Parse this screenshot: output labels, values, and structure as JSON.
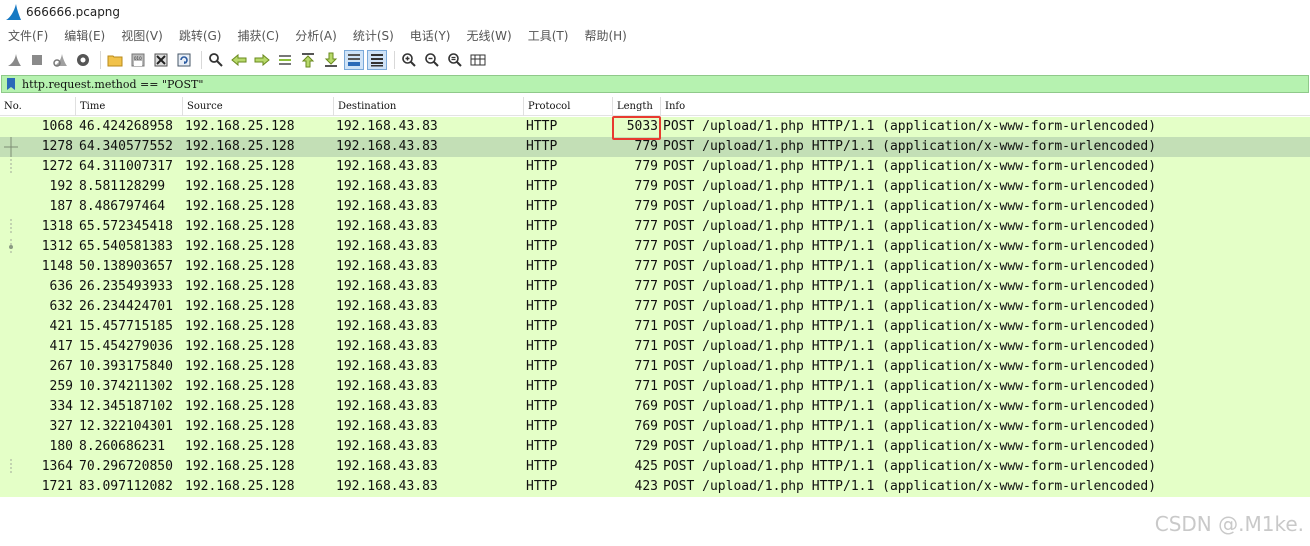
{
  "window": {
    "title": "666666.pcapng",
    "icon": "wireshark-fin-icon"
  },
  "menu": [
    {
      "label": "文件(F)"
    },
    {
      "label": "编辑(E)"
    },
    {
      "label": "视图(V)"
    },
    {
      "label": "跳转(G)"
    },
    {
      "label": "捕获(C)"
    },
    {
      "label": "分析(A)"
    },
    {
      "label": "统计(S)"
    },
    {
      "label": "电话(Y)"
    },
    {
      "label": "无线(W)"
    },
    {
      "label": "工具(T)"
    },
    {
      "label": "帮助(H)"
    }
  ],
  "toolbar": {
    "icons": [
      "start-capture-icon",
      "stop-capture-icon",
      "restart-capture-icon",
      "capture-options-icon",
      "open-file-icon",
      "save-file-icon",
      "close-file-icon",
      "reload-file-icon",
      "find-packet-icon",
      "go-back-icon",
      "go-forward-icon",
      "go-to-packet-icon",
      "first-packet-icon",
      "last-packet-icon",
      "autoscroll-icon",
      "colorize-icon",
      "zoom-in-icon",
      "zoom-out-icon",
      "zoom-normal-icon",
      "resize-columns-icon"
    ],
    "active_icons": [
      "autoscroll-icon",
      "colorize-icon"
    ]
  },
  "filter": {
    "value": "http.request.method == \"POST\"",
    "background": "#b6f2b0"
  },
  "columns": [
    "No.",
    "Time",
    "Source",
    "Destination",
    "Protocol",
    "Length",
    "Info"
  ],
  "packets": [
    {
      "no": "1068",
      "time": "46.424268958",
      "src": "192.168.25.128",
      "dst": "192.168.43.83",
      "proto": "HTTP",
      "len": "5033",
      "info": "POST /upload/1.php HTTP/1.1  (application/x-www-form-urlencoded)"
    },
    {
      "no": "1278",
      "time": "64.340577552",
      "src": "192.168.25.128",
      "dst": "192.168.43.83",
      "proto": "HTTP",
      "len": "779",
      "info": "POST /upload/1.php HTTP/1.1  (application/x-www-form-urlencoded)"
    },
    {
      "no": "1272",
      "time": "64.311007317",
      "src": "192.168.25.128",
      "dst": "192.168.43.83",
      "proto": "HTTP",
      "len": "779",
      "info": "POST /upload/1.php HTTP/1.1  (application/x-www-form-urlencoded)"
    },
    {
      "no": "192",
      "time": "8.581128299",
      "src": "192.168.25.128",
      "dst": "192.168.43.83",
      "proto": "HTTP",
      "len": "779",
      "info": "POST /upload/1.php HTTP/1.1  (application/x-www-form-urlencoded)"
    },
    {
      "no": "187",
      "time": "8.486797464",
      "src": "192.168.25.128",
      "dst": "192.168.43.83",
      "proto": "HTTP",
      "len": "779",
      "info": "POST /upload/1.php HTTP/1.1  (application/x-www-form-urlencoded)"
    },
    {
      "no": "1318",
      "time": "65.572345418",
      "src": "192.168.25.128",
      "dst": "192.168.43.83",
      "proto": "HTTP",
      "len": "777",
      "info": "POST /upload/1.php HTTP/1.1  (application/x-www-form-urlencoded)"
    },
    {
      "no": "1312",
      "time": "65.540581383",
      "src": "192.168.25.128",
      "dst": "192.168.43.83",
      "proto": "HTTP",
      "len": "777",
      "info": "POST /upload/1.php HTTP/1.1  (application/x-www-form-urlencoded)"
    },
    {
      "no": "1148",
      "time": "50.138903657",
      "src": "192.168.25.128",
      "dst": "192.168.43.83",
      "proto": "HTTP",
      "len": "777",
      "info": "POST /upload/1.php HTTP/1.1  (application/x-www-form-urlencoded)"
    },
    {
      "no": "636",
      "time": "26.235493933",
      "src": "192.168.25.128",
      "dst": "192.168.43.83",
      "proto": "HTTP",
      "len": "777",
      "info": "POST /upload/1.php HTTP/1.1  (application/x-www-form-urlencoded)"
    },
    {
      "no": "632",
      "time": "26.234424701",
      "src": "192.168.25.128",
      "dst": "192.168.43.83",
      "proto": "HTTP",
      "len": "777",
      "info": "POST /upload/1.php HTTP/1.1  (application/x-www-form-urlencoded)"
    },
    {
      "no": "421",
      "time": "15.457715185",
      "src": "192.168.25.128",
      "dst": "192.168.43.83",
      "proto": "HTTP",
      "len": "771",
      "info": "POST /upload/1.php HTTP/1.1  (application/x-www-form-urlencoded)"
    },
    {
      "no": "417",
      "time": "15.454279036",
      "src": "192.168.25.128",
      "dst": "192.168.43.83",
      "proto": "HTTP",
      "len": "771",
      "info": "POST /upload/1.php HTTP/1.1  (application/x-www-form-urlencoded)"
    },
    {
      "no": "267",
      "time": "10.393175840",
      "src": "192.168.25.128",
      "dst": "192.168.43.83",
      "proto": "HTTP",
      "len": "771",
      "info": "POST /upload/1.php HTTP/1.1  (application/x-www-form-urlencoded)"
    },
    {
      "no": "259",
      "time": "10.374211302",
      "src": "192.168.25.128",
      "dst": "192.168.43.83",
      "proto": "HTTP",
      "len": "771",
      "info": "POST /upload/1.php HTTP/1.1  (application/x-www-form-urlencoded)"
    },
    {
      "no": "334",
      "time": "12.345187102",
      "src": "192.168.25.128",
      "dst": "192.168.43.83",
      "proto": "HTTP",
      "len": "769",
      "info": "POST /upload/1.php HTTP/1.1  (application/x-www-form-urlencoded)"
    },
    {
      "no": "327",
      "time": "12.322104301",
      "src": "192.168.25.128",
      "dst": "192.168.43.83",
      "proto": "HTTP",
      "len": "769",
      "info": "POST /upload/1.php HTTP/1.1  (application/x-www-form-urlencoded)"
    },
    {
      "no": "180",
      "time": "8.260686231",
      "src": "192.168.25.128",
      "dst": "192.168.43.83",
      "proto": "HTTP",
      "len": "729",
      "info": "POST /upload/1.php HTTP/1.1  (application/x-www-form-urlencoded)"
    },
    {
      "no": "1364",
      "time": "70.296720850",
      "src": "192.168.25.128",
      "dst": "192.168.43.83",
      "proto": "HTTP",
      "len": "425",
      "info": "POST /upload/1.php HTTP/1.1  (application/x-www-form-urlencoded)"
    },
    {
      "no": "1721",
      "time": "83.097112082",
      "src": "192.168.25.128",
      "dst": "192.168.43.83",
      "proto": "HTTP",
      "len": "423",
      "info": "POST /upload/1.php HTTP/1.1  (application/x-www-form-urlencoded)"
    }
  ],
  "selected_packet": "1278",
  "highlighted_packet": "1068",
  "colors": {
    "row_bg": "#e4ffc7",
    "selected_bg": "#c3dfb6",
    "highlight_border": "#e83a2f"
  },
  "watermark": "CSDN @.M1ke."
}
